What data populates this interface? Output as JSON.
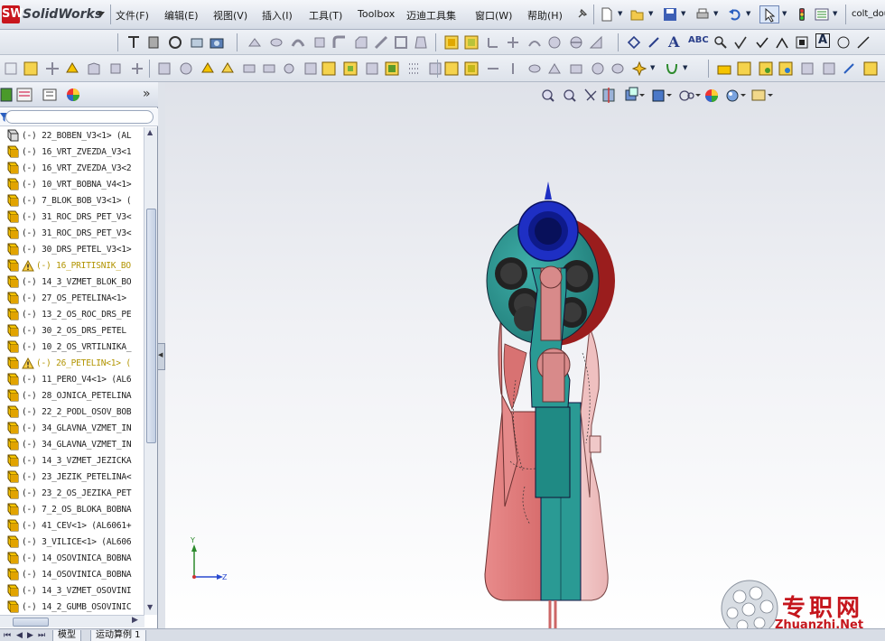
{
  "app": {
    "name": "SolidWorks",
    "file_title": "colt_dou"
  },
  "menu": [
    "文件(F)",
    "编辑(E)",
    "视图(V)",
    "插入(I)",
    "工具(T)",
    "Toolbox",
    "迈迪工具集",
    "窗口(W)",
    "帮助(H)"
  ],
  "panel": {
    "collapse_glyph": "»"
  },
  "tree": [
    {
      "label": "(-) 22_BOBEN_V3<1> (AL",
      "warn": false
    },
    {
      "label": "(-) 16_VRT_ZVEZDA_V3<1",
      "warn": false
    },
    {
      "label": "(-) 16_VRT_ZVEZDA_V3<2",
      "warn": false
    },
    {
      "label": "(-) 10_VRT_BOBNA_V4<1>",
      "warn": false
    },
    {
      "label": "(-) 7_BLOK_BOB_V3<1> (",
      "warn": false
    },
    {
      "label": "(-) 31_ROC_DRS_PET_V3<",
      "warn": false
    },
    {
      "label": "(-) 31_ROC_DRS_PET_V3<",
      "warn": false
    },
    {
      "label": "(-) 30_DRS_PETEL_V3<1>",
      "warn": false
    },
    {
      "label": "(-) 16_PRITISNIK_BO",
      "warn": true
    },
    {
      "label": "(-) 14_3_VZMET_BLOK_BO",
      "warn": false
    },
    {
      "label": "(-) 27_OS_PETELINA<1>",
      "warn": false
    },
    {
      "label": "(-) 13_2_OS_ROC_DRS_PE",
      "warn": false
    },
    {
      "label": "(-) 30_2_OS_DRS_PETEL",
      "warn": false
    },
    {
      "label": "(-) 10_2_OS_VRTILNIKA_",
      "warn": false
    },
    {
      "label": "(-) 26_PETELIN<1> (",
      "warn": true
    },
    {
      "label": "(-) 11_PERO_V4<1> (AL6",
      "warn": false
    },
    {
      "label": "(-) 28_OJNICA_PETELINA",
      "warn": false
    },
    {
      "label": "(-) 22_2_PODL_OSOV_BOB",
      "warn": false
    },
    {
      "label": "(-) 34_GLAVNA_VZMET_IN",
      "warn": false
    },
    {
      "label": "(-) 34_GLAVNA_VZMET_IN",
      "warn": false
    },
    {
      "label": "(-) 14_3_VZMET_JEZICKA",
      "warn": false
    },
    {
      "label": "(-) 23_JEZIK_PETELINA<",
      "warn": false
    },
    {
      "label": "(-) 23_2_OS_JEZIKA_PET",
      "warn": false
    },
    {
      "label": "(-) 7_2_OS_BLOKA_BOBNA",
      "warn": false
    },
    {
      "label": "(-) 41_CEV<1> (AL6061+",
      "warn": false
    },
    {
      "label": "(-) 3_VILICE<1> (AL606",
      "warn": false
    },
    {
      "label": "(-) 14_OSOVINICA_BOBNA",
      "warn": false
    },
    {
      "label": "(-) 14_OSOVINICA_BOBNA",
      "warn": false
    },
    {
      "label": "(-) 14_3_VZMET_OSOVINI",
      "warn": false
    },
    {
      "label": "(-) 14_2_GUMB_OSOVINIC",
      "warn": false
    }
  ],
  "bottom_tabs": [
    "模型",
    "运动算例 1"
  ],
  "triad": {
    "y": "Y",
    "z": "Z"
  },
  "watermark": {
    "text": "专职网",
    "sub": "Zhuanzhi.Net"
  },
  "colors": {
    "accent_red": "#c8161d",
    "teal": "#2c9a94",
    "salmon": "#e58a8a",
    "blue": "#1e2fc4"
  }
}
